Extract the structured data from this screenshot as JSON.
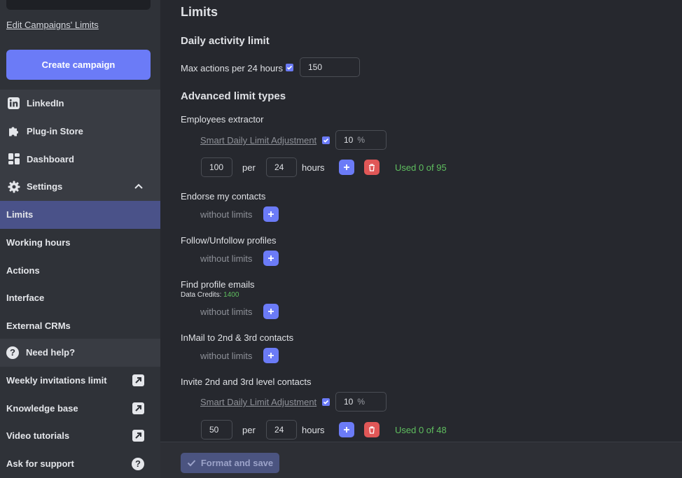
{
  "sidebar": {
    "edit_link": "Edit Campaigns' Limits",
    "create_button": "Create campaign",
    "nav": [
      {
        "label": "LinkedIn",
        "icon": "linkedin-icon"
      },
      {
        "label": "Plug-in Store",
        "icon": "puzzle-icon"
      },
      {
        "label": "Dashboard",
        "icon": "dashboard-icon"
      },
      {
        "label": "Settings",
        "icon": "gear-icon"
      }
    ],
    "settings_items": [
      "Limits",
      "Working hours",
      "Actions",
      "Interface",
      "External CRMs"
    ],
    "active_item": "Limits",
    "help": {
      "title": "Need help?",
      "items": [
        "Weekly invitations limit",
        "Knowledge base",
        "Video tutorials",
        "Ask for support"
      ]
    }
  },
  "main": {
    "title": "Limits",
    "daily": {
      "title": "Daily activity limit",
      "label": "Max actions per 24 hours",
      "checked": true,
      "value": "150"
    },
    "advanced_title": "Advanced limit types",
    "per_label": "per",
    "hours_label": "hours",
    "smart_label": "Smart Daily Limit Adjustment",
    "percent_sign": "%",
    "without_limits": "without limits",
    "limits": [
      {
        "name": "Employees extractor",
        "smart_value": "10",
        "count": "100",
        "hours": "24",
        "used": "Used 0 of 95"
      },
      {
        "name": "Endorse my contacts"
      },
      {
        "name": "Follow/Unfollow profiles"
      },
      {
        "name": "Find profile emails",
        "credits_label": "Data Credits:",
        "credits_value": "1400"
      },
      {
        "name": "InMail to 2nd & 3rd contacts"
      },
      {
        "name": "Invite 2nd and 3rd level contacts",
        "smart_value": "10",
        "count": "50",
        "hours": "24",
        "used": "Used 0 of 48"
      }
    ],
    "save_button": "Format and save"
  },
  "colors": {
    "accent": "#6b7bf7",
    "danger": "#e05757",
    "success": "#5fbf5f",
    "active_nav": "#4a5289"
  }
}
